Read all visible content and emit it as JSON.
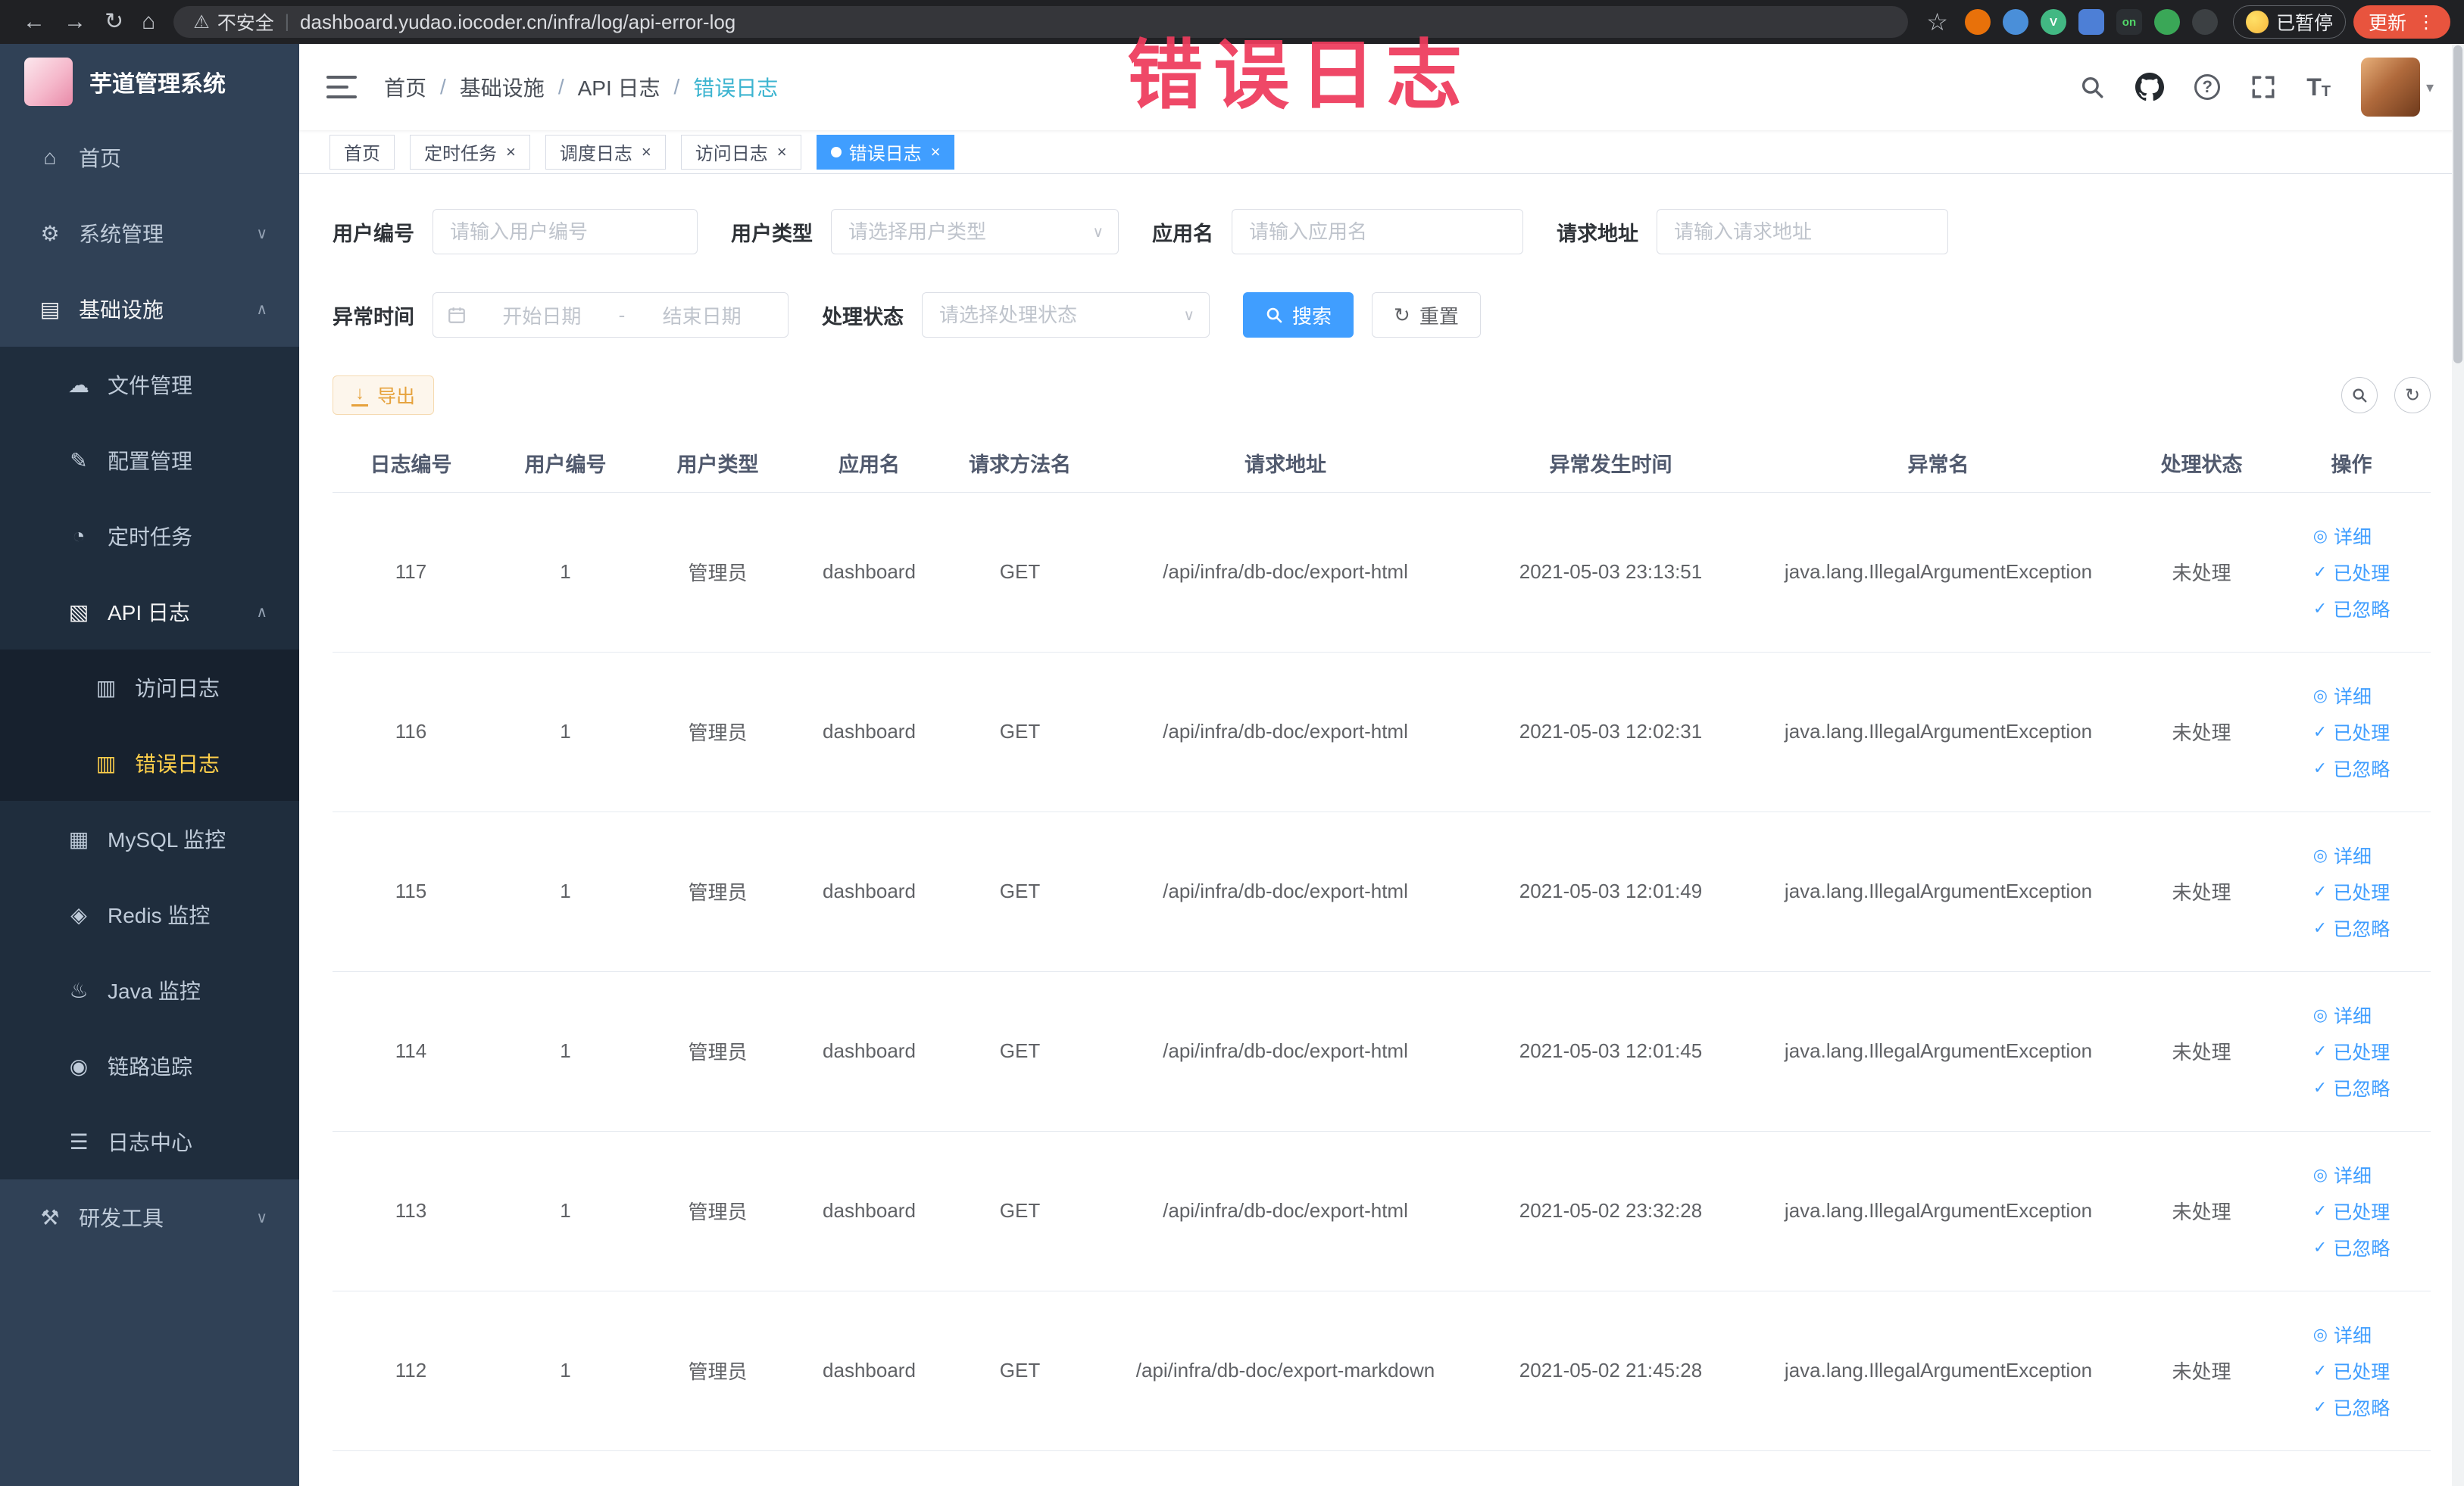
{
  "colors": {
    "primary": "#409eff",
    "sidebar_bg": "#304156",
    "sidebar_submenu_bg": "#1f2d3d",
    "sidebar_active_text": "#ffd04b",
    "active_tab_bg": "#409eff",
    "breadcrumb_current": "#3cb4d0",
    "stamp_red": "#ee3b5c",
    "export_button_text": "#e6a23c",
    "update_button_bg": "#e8543e",
    "chrome_bg": "#202124"
  },
  "browser": {
    "security_label": "不安全",
    "url": "dashboard.yudao.iocoder.cn/infra/log/api-error-log",
    "paused_label": "已暂停",
    "update_label": "更新",
    "extensions": [
      {
        "name": "extension-dot-icon",
        "color": "#e8710a",
        "shape": "circle",
        "text": ""
      },
      {
        "name": "extension-drop-icon",
        "color": "#4a8fd9",
        "shape": "circle",
        "text": ""
      },
      {
        "name": "vue-devtools-icon",
        "color": "#42b883",
        "shape": "circle",
        "text": "V",
        "text_color": "#ffffff"
      },
      {
        "name": "extension-grid-icon",
        "color": "#4d7fd6",
        "shape": "square",
        "text": ""
      },
      {
        "name": "switch-on-icon",
        "color": "#2b2f33",
        "shape": "square",
        "text": "on",
        "text_color": "#52d869"
      },
      {
        "name": "extension-leaf-icon",
        "color": "#3aa757",
        "shape": "circle",
        "text": ""
      },
      {
        "name": "extension-paw-icon",
        "color": "#3c4043",
        "shape": "circle",
        "text": ""
      }
    ]
  },
  "stamp_text": "错误日志",
  "sidebar": {
    "app_title": "芋道管理系统",
    "items": [
      {
        "name": "home",
        "label": "首页",
        "icon": "home-icon",
        "level": 1
      },
      {
        "name": "system-management",
        "label": "系统管理",
        "icon": "gear-icon",
        "level": 1,
        "expandable": true,
        "expanded": false
      },
      {
        "name": "infrastructure",
        "label": "基础设施",
        "icon": "infrastructure-icon",
        "level": 1,
        "expandable": true,
        "expanded": true,
        "open": true
      },
      {
        "name": "file-management",
        "label": "文件管理",
        "icon": "cloud-icon",
        "level": 2
      },
      {
        "name": "config-management",
        "label": "配置管理",
        "icon": "edit-icon",
        "level": 2
      },
      {
        "name": "scheduled-tasks",
        "label": "定时任务",
        "icon": "timer-icon",
        "level": 2
      },
      {
        "name": "api-logs",
        "label": "API 日志",
        "icon": "api-log-icon",
        "level": 2,
        "expandable": true,
        "expanded": true,
        "open": true
      },
      {
        "name": "access-log",
        "label": "访问日志",
        "icon": "access-log-icon",
        "level": 3
      },
      {
        "name": "error-log",
        "label": "错误日志",
        "icon": "error-log-icon",
        "level": 3,
        "active": true
      },
      {
        "name": "mysql-monitor",
        "label": "MySQL 监控",
        "icon": "mysql-icon",
        "level": 2
      },
      {
        "name": "redis-monitor",
        "label": "Redis 监控",
        "icon": "redis-icon",
        "level": 2
      },
      {
        "name": "java-monitor",
        "label": "Java 监控",
        "icon": "java-icon",
        "level": 2
      },
      {
        "name": "trace",
        "label": "链路追踪",
        "icon": "trace-icon",
        "level": 2
      },
      {
        "name": "log-center",
        "label": "日志中心",
        "icon": "log-center-icon",
        "level": 2
      },
      {
        "name": "dev-tools",
        "label": "研发工具",
        "icon": "dev-tools-icon",
        "level": 1,
        "expandable": true,
        "expanded": false
      }
    ]
  },
  "header": {
    "breadcrumb": [
      {
        "name": "home",
        "label": "首页"
      },
      {
        "name": "infrastructure",
        "label": "基础设施"
      },
      {
        "name": "api-logs",
        "label": "API 日志"
      },
      {
        "name": "error-log",
        "label": "错误日志",
        "current": true
      }
    ]
  },
  "tabs": [
    {
      "name": "tab-home",
      "label": "首页",
      "closable": false,
      "active": false
    },
    {
      "name": "tab-timed-task",
      "label": "定时任务",
      "closable": true,
      "active": false
    },
    {
      "name": "tab-job-log",
      "label": "调度日志",
      "closable": true,
      "active": false
    },
    {
      "name": "tab-access-log",
      "label": "访问日志",
      "closable": true,
      "active": false
    },
    {
      "name": "tab-error-log",
      "label": "错误日志",
      "closable": true,
      "active": true
    }
  ],
  "filters": {
    "user_id": {
      "label": "用户编号",
      "placeholder": "请输入用户编号"
    },
    "user_type": {
      "label": "用户类型",
      "placeholder": "请选择用户类型"
    },
    "app_name": {
      "label": "应用名",
      "placeholder": "请输入应用名"
    },
    "request_url": {
      "label": "请求地址",
      "placeholder": "请输入请求地址"
    },
    "exception_time": {
      "label": "异常时间",
      "start_placeholder": "开始日期",
      "separator": "-",
      "end_placeholder": "结束日期"
    },
    "process_status": {
      "label": "处理状态",
      "placeholder": "请选择处理状态"
    },
    "search_label": "搜索",
    "reset_label": "重置"
  },
  "toolbar": {
    "export_label": "导出"
  },
  "table": {
    "columns": [
      "日志编号",
      "用户编号",
      "用户类型",
      "应用名",
      "请求方法名",
      "请求地址",
      "异常发生时间",
      "异常名",
      "处理状态",
      "操作"
    ],
    "actions": [
      {
        "name": "detail-link",
        "label": "详细",
        "icon": "view-icon"
      },
      {
        "name": "mark-processed-link",
        "label": "已处理",
        "icon": "check-icon"
      },
      {
        "name": "mark-ignored-link",
        "label": "已忽略",
        "icon": "check-icon"
      }
    ],
    "rows": [
      {
        "id": "117",
        "user_id": "1",
        "user_type": "管理员",
        "app": "dashboard",
        "method": "GET",
        "url": "/api/infra/db-doc/export-html",
        "time": "2021-05-03 23:13:51",
        "exception": "java.lang.IllegalArgumentException",
        "status": "未处理"
      },
      {
        "id": "116",
        "user_id": "1",
        "user_type": "管理员",
        "app": "dashboard",
        "method": "GET",
        "url": "/api/infra/db-doc/export-html",
        "time": "2021-05-03 12:02:31",
        "exception": "java.lang.IllegalArgumentException",
        "status": "未处理"
      },
      {
        "id": "115",
        "user_id": "1",
        "user_type": "管理员",
        "app": "dashboard",
        "method": "GET",
        "url": "/api/infra/db-doc/export-html",
        "time": "2021-05-03 12:01:49",
        "exception": "java.lang.IllegalArgumentException",
        "status": "未处理"
      },
      {
        "id": "114",
        "user_id": "1",
        "user_type": "管理员",
        "app": "dashboard",
        "method": "GET",
        "url": "/api/infra/db-doc/export-html",
        "time": "2021-05-03 12:01:45",
        "exception": "java.lang.IllegalArgumentException",
        "status": "未处理"
      },
      {
        "id": "113",
        "user_id": "1",
        "user_type": "管理员",
        "app": "dashboard",
        "method": "GET",
        "url": "/api/infra/db-doc/export-html",
        "time": "2021-05-02 23:32:28",
        "exception": "java.lang.IllegalArgumentException",
        "status": "未处理"
      },
      {
        "id": "112",
        "user_id": "1",
        "user_type": "管理员",
        "app": "dashboard",
        "method": "GET",
        "url": "/api/infra/db-doc/export-markdown",
        "time": "2021-05-02 21:45:28",
        "exception": "java.lang.IllegalArgumentException",
        "status": "未处理"
      }
    ]
  },
  "icon_glyphs": {
    "home-icon": "⌂",
    "gear-icon": "⚙",
    "infrastructure-icon": "▤",
    "cloud-icon": "☁",
    "edit-icon": "✎",
    "timer-icon": "◔",
    "api-log-icon": "▧",
    "access-log-icon": "▥",
    "error-log-icon": "▥",
    "mysql-icon": "▦",
    "redis-icon": "◈",
    "java-icon": "♨",
    "trace-icon": "◉",
    "log-center-icon": "☰",
    "dev-tools-icon": "⚒",
    "view-icon": "◎",
    "check-icon": "✓",
    "chevron-up-icon": "∧",
    "chevron-down-icon": "∨"
  }
}
